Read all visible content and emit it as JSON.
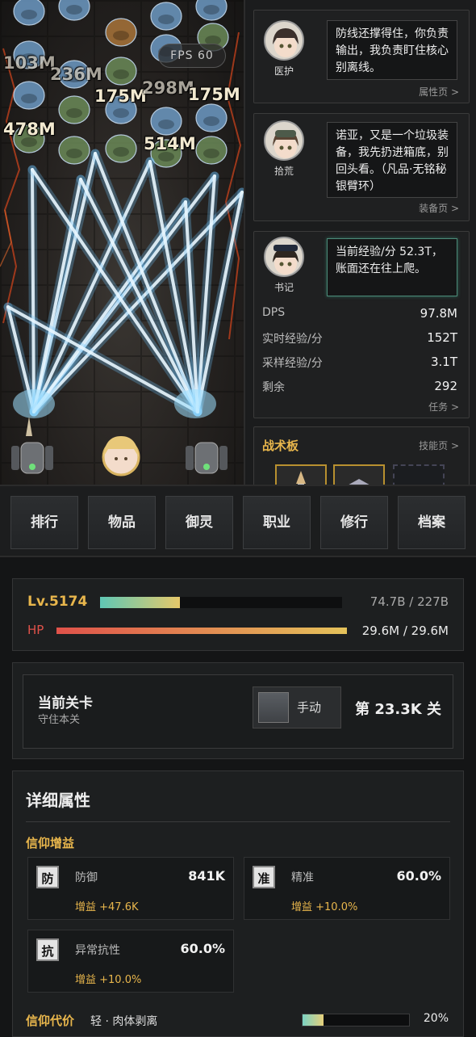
{
  "battle": {
    "fps": "FPS 60",
    "damage": [
      "103M",
      "236M",
      "175M",
      "298M",
      "175M",
      "478M",
      "514M"
    ]
  },
  "side": {
    "medic": {
      "name": "医护",
      "line": "防线还撑得住，你负责输出，我负责盯住核心别离线。",
      "link": "属性页 >"
    },
    "scav": {
      "name": "拾荒",
      "line": "诺亚，又是一个垃圾装备，我先扔进箱底，别回头看。（凡品·无铭秘银臂环）",
      "link": "装备页 >"
    },
    "clerk": {
      "name": "书记",
      "line": "当前经验/分 52.3T，账面还在往上爬。"
    },
    "stats": [
      {
        "label": "DPS",
        "value": "97.8M"
      },
      {
        "label": "实时经验/分",
        "value": "152T"
      },
      {
        "label": "采样经验/分",
        "value": "3.1T"
      },
      {
        "label": "剩余",
        "value": "292"
      }
    ],
    "task_link": "任务 >",
    "board": {
      "title": "战术板",
      "link": "技能页 >"
    }
  },
  "tabs": [
    "排行",
    "物品",
    "御灵",
    "职业",
    "修行",
    "档案"
  ],
  "status": {
    "level": "Lv.5174",
    "exp_text": "74.7B / 227B",
    "exp_fraction": 0.33,
    "hp_label": "HP",
    "hp_text": "29.6M / 29.6M",
    "hp_fraction": 1.0
  },
  "stage": {
    "title": "当前关卡",
    "subtitle": "守住本关",
    "mode_label": "手动",
    "stage_text": "第 23.3K 关"
  },
  "details": {
    "title": "详细属性",
    "faith_title": "信仰增益",
    "attrs": [
      {
        "tag": "防",
        "name": "防御",
        "value": "841K",
        "bonus": "增益 +47.6K"
      },
      {
        "tag": "准",
        "name": "精准",
        "value": "60.0%",
        "bonus": "增益 +10.0%"
      },
      {
        "tag": "抗",
        "name": "异常抗性",
        "value": "60.0%",
        "bonus": "增益 +10.0%"
      }
    ],
    "cost_title": "信仰代价",
    "cost_desc": "轻 · 肉体剥离",
    "cost_percent": "20%",
    "cost_fraction": 0.2
  },
  "colors": {
    "accent": "#e8b64c",
    "hp": "#e0524a",
    "exp": "#7bd3b0",
    "beam": "#bfe6ff"
  }
}
